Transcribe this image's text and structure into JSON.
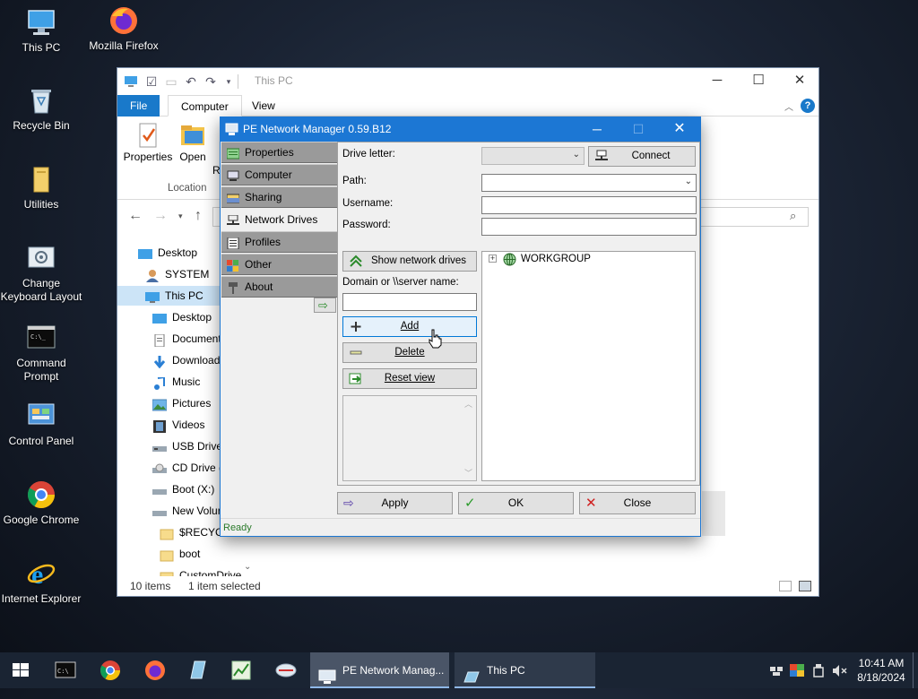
{
  "desktop": {
    "icons": [
      {
        "label": "This PC",
        "icon": "this-pc-icon"
      },
      {
        "label": "Mozilla Firefox",
        "icon": "firefox-icon"
      },
      {
        "label": "Recycle Bin",
        "icon": "recycle-bin-icon"
      },
      {
        "label": "Utilities",
        "icon": "folder-icon"
      },
      {
        "label": "Change Keyboard Layout",
        "icon": "keyboard-settings-icon"
      },
      {
        "label": "Command Prompt",
        "icon": "command-prompt-icon"
      },
      {
        "label": "Control Panel",
        "icon": "control-panel-icon"
      },
      {
        "label": "Google Chrome",
        "icon": "chrome-icon"
      },
      {
        "label": "Internet Explorer",
        "icon": "internet-explorer-icon"
      }
    ]
  },
  "explorer": {
    "title": "This PC",
    "tabs": {
      "file": "File",
      "computer": "Computer",
      "view": "View"
    },
    "ribbon": {
      "properties": "Properties",
      "open": "Open",
      "rename_partial": "R",
      "group_location": "Location"
    },
    "nav_tree": [
      {
        "label": "Desktop",
        "icon": "desktop-icon"
      },
      {
        "label": "SYSTEM",
        "icon": "user-icon"
      },
      {
        "label": "This PC",
        "icon": "this-pc-icon"
      },
      {
        "label": "Desktop",
        "icon": "desktop-icon"
      },
      {
        "label": "Document",
        "icon": "documents-icon"
      },
      {
        "label": "Download",
        "icon": "downloads-icon"
      },
      {
        "label": "Music",
        "icon": "music-icon"
      },
      {
        "label": "Pictures",
        "icon": "pictures-icon"
      },
      {
        "label": "Videos",
        "icon": "videos-icon"
      },
      {
        "label": "USB Drive",
        "icon": "usb-drive-icon"
      },
      {
        "label": "CD Drive (",
        "icon": "cd-drive-icon"
      },
      {
        "label": "Boot (X:)",
        "icon": "drive-icon"
      },
      {
        "label": "New Volur",
        "icon": "drive-icon"
      },
      {
        "label": "$RECYCL",
        "icon": "folder-icon"
      },
      {
        "label": "boot",
        "icon": "folder-icon"
      },
      {
        "label": "CustomDrive",
        "icon": "folder-icon"
      }
    ],
    "status": {
      "items": "10 items",
      "selected": "1 item selected"
    }
  },
  "pe": {
    "title": "PE Network Manager 0.59.B12",
    "sidebar": [
      {
        "label": "Properties",
        "icon": "properties-icon"
      },
      {
        "label": "Computer",
        "icon": "computer-icon"
      },
      {
        "label": "Sharing",
        "icon": "sharing-icon"
      },
      {
        "label": "Network Drives",
        "icon": "network-drives-icon"
      },
      {
        "label": "Profiles",
        "icon": "profiles-icon"
      },
      {
        "label": "Other",
        "icon": "other-icon"
      },
      {
        "label": "About",
        "icon": "about-icon"
      }
    ],
    "form": {
      "drive_letter_label": "Drive letter:",
      "connect": "Connect",
      "path_label": "Path:",
      "username_label": "Username:",
      "password_label": "Password:",
      "show_network_drives": "Show network drives",
      "domain_label": "Domain or \\\\server name:",
      "add": "Add",
      "delete": "Delete",
      "reset_view": "Reset view"
    },
    "tree": {
      "root": "WORKGROUP"
    },
    "buttons": {
      "apply": "Apply",
      "ok": "OK",
      "close": "Close"
    },
    "status": "Ready"
  },
  "taskbar": {
    "windows": [
      {
        "label": "PE Network Manag...",
        "active": true
      },
      {
        "label": "This PC",
        "active": false
      }
    ],
    "clock": {
      "time": "10:41 AM",
      "date": "8/18/2024"
    }
  },
  "colors": {
    "accent": "#1c77d4",
    "taskbar": "#1a2433",
    "ready_text": "#2a7a2a"
  }
}
